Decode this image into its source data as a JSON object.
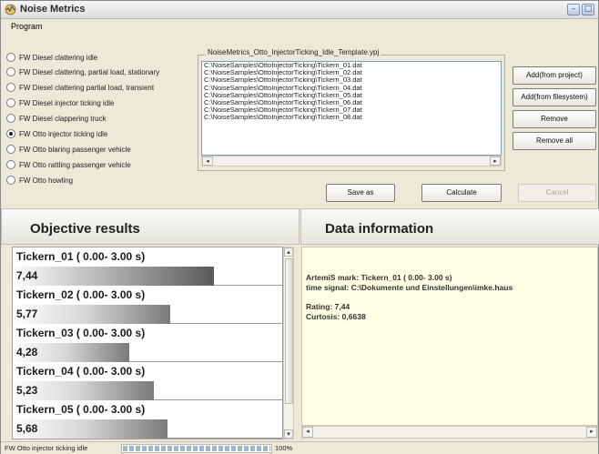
{
  "window": {
    "title": "Noise Metrics"
  },
  "menu": {
    "program": "Program"
  },
  "templates": [
    {
      "label": "FW Diesel clattering idle",
      "selected": false
    },
    {
      "label": "FW Diesel clattering, partial load, stationary",
      "selected": false
    },
    {
      "label": "FW Diesel clattering partial load, transient",
      "selected": false
    },
    {
      "label": "FW Diesel injector ticking idle",
      "selected": false
    },
    {
      "label": "FW Diesel clappering truck",
      "selected": false
    },
    {
      "label": "FW Otto injector ticking idle",
      "selected": true
    },
    {
      "label": "FW Otto blaring passenger vehicle",
      "selected": false
    },
    {
      "label": "FW Otto rattling passenger vehicle",
      "selected": false
    },
    {
      "label": "FW Otto howling",
      "selected": false
    }
  ],
  "file_group": {
    "legend": "NoiseMetrics_Otto_InjectorTicking_Idle_Template.ypj"
  },
  "files": [
    "C:\\NoiseSamples\\OttoInjectorTicking\\Tickern_01.dat",
    "C:\\NoiseSamples\\OttoInjectorTicking\\Tickern_02.dat",
    "C:\\NoiseSamples\\OttoInjectorTicking\\Tickern_03.dat",
    "C:\\NoiseSamples\\OttoInjectorTicking\\Tickern_04.dat",
    "C:\\NoiseSamples\\OttoInjectorTicking\\Tickern_05.dat",
    "C:\\NoiseSamples\\OttoInjectorTicking\\Tickern_06.dat",
    "C:\\NoiseSamples\\OttoInjectorTicking\\Tickern_07.dat",
    "C:\\NoiseSamples\\OttoInjectorTicking\\Tickern_08.dat"
  ],
  "buttons": {
    "add_project": "Add(from project)",
    "add_filesystem": "Add(from filesystem)",
    "remove": "Remove",
    "remove_all": "Remove all",
    "save_as": "Save as",
    "calculate": "Calculate",
    "cancel": "Cancel"
  },
  "results": {
    "title": "Objective results",
    "items": [
      {
        "name": "Tickern_01 ( 0.00- 3.00 s)",
        "value": "7,44",
        "level": 0.74,
        "selected": true
      },
      {
        "name": "Tickern_02 ( 0.00- 3.00 s)",
        "value": "5,77",
        "level": 0.58,
        "selected": false
      },
      {
        "name": "Tickern_03 ( 0.00- 3.00 s)",
        "value": "4,28",
        "level": 0.43,
        "selected": false
      },
      {
        "name": "Tickern_04 ( 0.00- 3.00 s)",
        "value": "5,23",
        "level": 0.52,
        "selected": false
      },
      {
        "name": "Tickern_05 ( 0.00- 3.00 s)",
        "value": "5,68",
        "level": 0.57,
        "selected": false
      }
    ]
  },
  "info": {
    "title": "Data information",
    "mark": "ArtemiS mark: Tickern_01 ( 0.00- 3.00 s)",
    "signal": "time signal:  C:\\Dokumente und Einstellungen\\imke.haus",
    "rating": "Rating: 7,44",
    "curtosis": "  Curtosis: 0,6638"
  },
  "status": {
    "text": "FW Otto injector ticking idle",
    "progress_percent": 100,
    "progress_label": "100%"
  },
  "colors": {
    "window_bg": "#ece9d8",
    "info_bg": "#ffffe6",
    "progress": "#9fb6cf"
  }
}
